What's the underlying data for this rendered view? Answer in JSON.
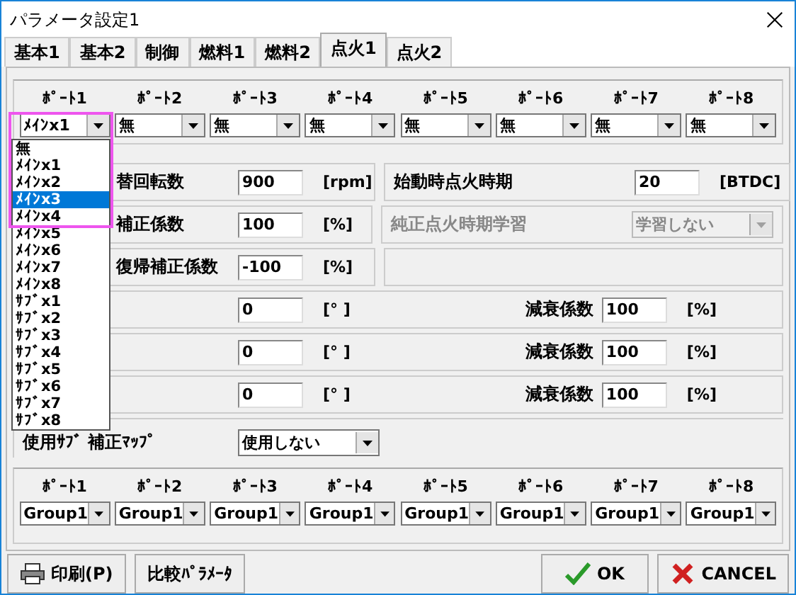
{
  "window": {
    "title": "パラメータ設定1"
  },
  "tabs": [
    {
      "label": "基本1",
      "selected": false
    },
    {
      "label": "基本2",
      "selected": false
    },
    {
      "label": "制御",
      "selected": false
    },
    {
      "label": "燃料1",
      "selected": false
    },
    {
      "label": "燃料2",
      "selected": false
    },
    {
      "label": "点火1",
      "selected": true
    },
    {
      "label": "点火2",
      "selected": false
    }
  ],
  "ports_top": [
    {
      "label": "ﾎﾟｰﾄ1",
      "value": "ﾒｲﾝx1"
    },
    {
      "label": "ﾎﾟｰﾄ2",
      "value": "無"
    },
    {
      "label": "ﾎﾟｰﾄ3",
      "value": "無"
    },
    {
      "label": "ﾎﾟｰﾄ4",
      "value": "無"
    },
    {
      "label": "ﾎﾟｰﾄ5",
      "value": "無"
    },
    {
      "label": "ﾎﾟｰﾄ6",
      "value": "無"
    },
    {
      "label": "ﾎﾟｰﾄ7",
      "value": "無"
    },
    {
      "label": "ﾎﾟｰﾄ8",
      "value": "無"
    }
  ],
  "dropdown": {
    "options": [
      {
        "label": "無",
        "selected": false
      },
      {
        "label": "ﾒｲﾝx1",
        "selected": false
      },
      {
        "label": "ﾒｲﾝx2",
        "selected": false
      },
      {
        "label": "ﾒｲﾝx3",
        "selected": true
      },
      {
        "label": "ﾒｲﾝx4",
        "selected": false
      },
      {
        "label": "ﾒｲﾝx5",
        "selected": false
      },
      {
        "label": "ﾒｲﾝx6",
        "selected": false
      },
      {
        "label": "ﾒｲﾝx7",
        "selected": false
      },
      {
        "label": "ﾒｲﾝx8",
        "selected": false
      },
      {
        "label": "ｻﾌﾞx1",
        "selected": false
      },
      {
        "label": "ｻﾌﾞx2",
        "selected": false
      },
      {
        "label": "ｻﾌﾞx3",
        "selected": false
      },
      {
        "label": "ｻﾌﾞx4",
        "selected": false
      },
      {
        "label": "ｻﾌﾞx5",
        "selected": false
      },
      {
        "label": "ｻﾌﾞx6",
        "selected": false
      },
      {
        "label": "ｻﾌﾞx7",
        "selected": false
      },
      {
        "label": "ｻﾌﾞx8",
        "selected": false
      }
    ]
  },
  "rows": [
    {
      "kind": "split",
      "boxes": [
        {
          "fields": [
            {
              "kind": "field",
              "label": "替回転数",
              "value": "900",
              "unit": "[rpm]"
            }
          ]
        },
        {
          "fields": [
            {
              "kind": "field",
              "label": "始動時点火時期",
              "value": "20",
              "unit": "[BTDC]"
            }
          ]
        }
      ]
    },
    {
      "kind": "split",
      "boxes": [
        {
          "fields": [
            {
              "kind": "field",
              "label": "補正係数",
              "value": "100",
              "unit": "[%]"
            }
          ]
        },
        {
          "fields": [
            {
              "kind": "select",
              "label": "純正点火時期学習",
              "value": "学習しない",
              "disabled": true
            }
          ]
        }
      ]
    },
    {
      "kind": "split_blank",
      "boxes": [
        {
          "fields": [
            {
              "kind": "field",
              "label": "復帰補正係数",
              "value": "-100",
              "unit": "[%]"
            }
          ]
        }
      ]
    },
    {
      "kind": "wide",
      "boxes": [
        {
          "fields": [
            {
              "kind": "field",
              "value": "0",
              "unit": "[° ]"
            },
            {
              "kind": "field",
              "label": "減衰係数",
              "value": "100",
              "unit": "[%]"
            }
          ]
        }
      ]
    },
    {
      "kind": "wide",
      "boxes": [
        {
          "fields": [
            {
              "kind": "field",
              "value": "0",
              "unit": "[° ]"
            },
            {
              "kind": "field",
              "label": "減衰係数",
              "value": "100",
              "unit": "[%]"
            }
          ]
        }
      ]
    },
    {
      "kind": "wide",
      "boxes": [
        {
          "fields": [
            {
              "kind": "field",
              "value": "0",
              "unit": "[° ]"
            },
            {
              "kind": "field",
              "label": "減衰係数",
              "value": "100",
              "unit": "[%]"
            }
          ]
        }
      ]
    },
    {
      "kind": "plain",
      "boxes": [
        {
          "fields": [
            {
              "kind": "select",
              "label": "使用ｻﾌﾞ 補正ﾏｯﾌﾟ",
              "value": "使用しない",
              "disabled": false
            }
          ]
        }
      ]
    }
  ],
  "ports_bottom": [
    {
      "label": "ﾎﾟｰﾄ1",
      "value": "Group1"
    },
    {
      "label": "ﾎﾟｰﾄ2",
      "value": "Group1"
    },
    {
      "label": "ﾎﾟｰﾄ3",
      "value": "Group1"
    },
    {
      "label": "ﾎﾟｰﾄ4",
      "value": "Group1"
    },
    {
      "label": "ﾎﾟｰﾄ5",
      "value": "Group1"
    },
    {
      "label": "ﾎﾟｰﾄ6",
      "value": "Group1"
    },
    {
      "label": "ﾎﾟｰﾄ7",
      "value": "Group1"
    },
    {
      "label": "ﾎﾟｰﾄ8",
      "value": "Group1"
    }
  ],
  "buttons": [
    {
      "kind": "print",
      "label": "印刷(P)"
    },
    {
      "kind": "plain",
      "label": "比較ﾊﾟﾗﾒｰﾀ"
    },
    {
      "kind": "ok",
      "label": "OK"
    },
    {
      "kind": "cancel",
      "label": "CANCEL"
    }
  ]
}
